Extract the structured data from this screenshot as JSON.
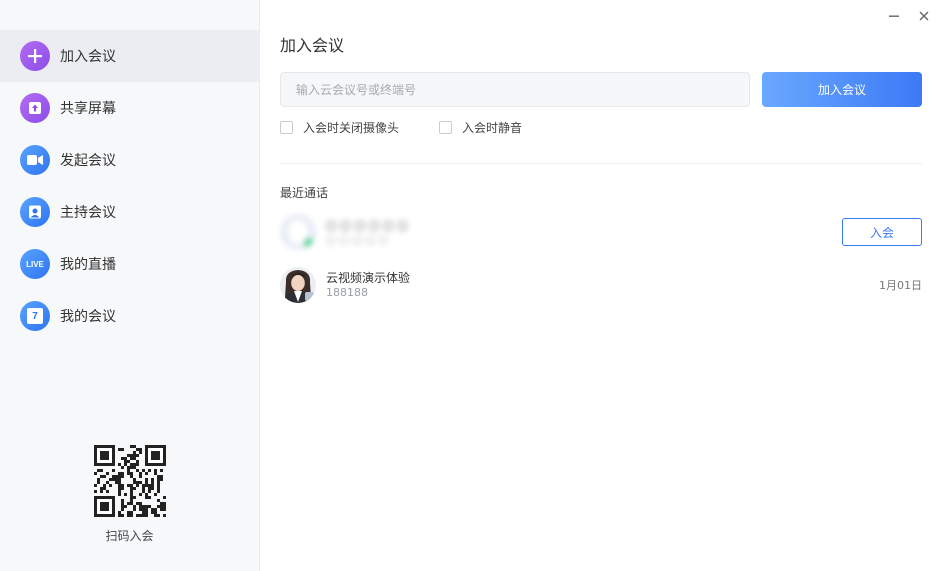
{
  "sidebar": {
    "items": [
      {
        "label": "加入会议",
        "icon": "plus-icon",
        "color": "#9b59ef",
        "active": true
      },
      {
        "label": "共享屏幕",
        "icon": "share-screen-icon",
        "color": "#9b59ef"
      },
      {
        "label": "发起会议",
        "icon": "video-camera-icon",
        "color": "#3b7af5"
      },
      {
        "label": "主持会议",
        "icon": "host-icon",
        "color": "#3b7af5"
      },
      {
        "label": "我的直播",
        "icon": "live-icon",
        "color": "#3b7af5",
        "badge": "LIVE"
      },
      {
        "label": "我的会议",
        "icon": "calendar-icon",
        "color": "#3b7af5",
        "badge": "7"
      }
    ],
    "qr_label": "扫码入会"
  },
  "main": {
    "title": "加入会议",
    "input_placeholder": "输入云会议号或终端号",
    "join_button": "加入会议",
    "options": {
      "camera_off": "入会时关闭摄像头",
      "mute": "入会时静音"
    },
    "recent_title": "最近通话",
    "recent_calls": [
      {
        "name": "○ ○ ○ ○ ○ ○",
        "id": "○ ○ ○ ○ ○",
        "blurred": true,
        "button": "入会"
      },
      {
        "name": "云视频演示体验",
        "id": "188188",
        "date": "1月01日"
      }
    ]
  },
  "colors": {
    "accent": "#3b7af5",
    "purple": "#9b59ef",
    "sidebar_bg": "#f7f8fa"
  }
}
